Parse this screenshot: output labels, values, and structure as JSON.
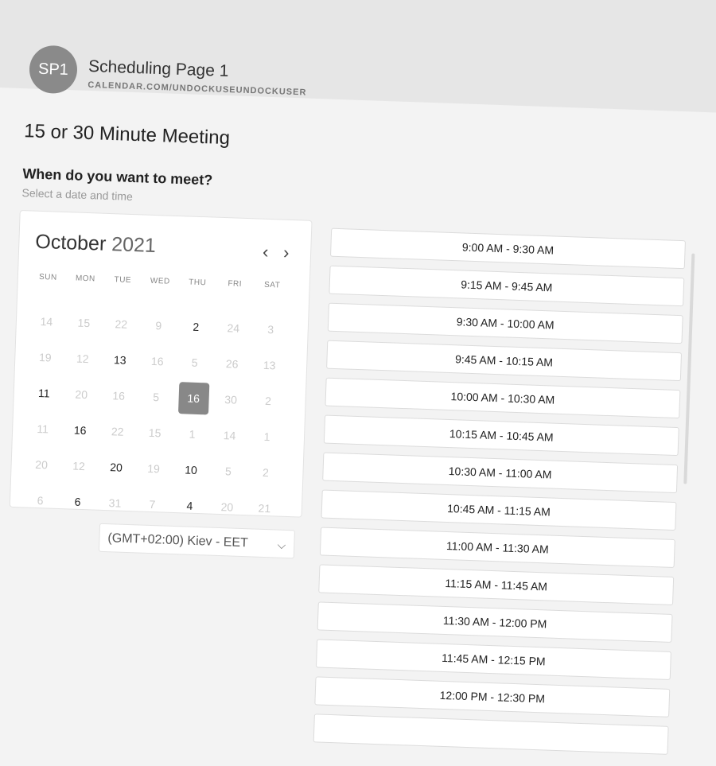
{
  "header": {
    "avatar_initials": "SP1",
    "title": "Scheduling Page 1",
    "url": "CALENDAR.COM/UNDOCKUSEUNDOCKUSER"
  },
  "meeting_title": "15 or 30 Minute Meeting",
  "question": "When do you want to meet?",
  "subquestion": "Select a date and time",
  "calendar": {
    "month": "October",
    "year": "2021",
    "prev_icon": "‹",
    "next_icon": "›",
    "weekdays": [
      "SUN",
      "MON",
      "TUE",
      "WED",
      "THU",
      "FRI",
      "SAT"
    ],
    "days": [
      {
        "n": "14",
        "a": false
      },
      {
        "n": "15",
        "a": false
      },
      {
        "n": "22",
        "a": false
      },
      {
        "n": "9",
        "a": false
      },
      {
        "n": "2",
        "a": true
      },
      {
        "n": "24",
        "a": false
      },
      {
        "n": "3",
        "a": false
      },
      {
        "n": "19",
        "a": false
      },
      {
        "n": "12",
        "a": false
      },
      {
        "n": "13",
        "a": true
      },
      {
        "n": "16",
        "a": false
      },
      {
        "n": "5",
        "a": false
      },
      {
        "n": "26",
        "a": false
      },
      {
        "n": "13",
        "a": false
      },
      {
        "n": "11",
        "a": true
      },
      {
        "n": "20",
        "a": false
      },
      {
        "n": "16",
        "a": false
      },
      {
        "n": "5",
        "a": false
      },
      {
        "n": "16",
        "a": true,
        "sel": true
      },
      {
        "n": "30",
        "a": false
      },
      {
        "n": "2",
        "a": false
      },
      {
        "n": "11",
        "a": false
      },
      {
        "n": "16",
        "a": true
      },
      {
        "n": "22",
        "a": false
      },
      {
        "n": "15",
        "a": false
      },
      {
        "n": "1",
        "a": false
      },
      {
        "n": "14",
        "a": false
      },
      {
        "n": "1",
        "a": false
      },
      {
        "n": "20",
        "a": false
      },
      {
        "n": "12",
        "a": false
      },
      {
        "n": "20",
        "a": true
      },
      {
        "n": "19",
        "a": false
      },
      {
        "n": "10",
        "a": true
      },
      {
        "n": "5",
        "a": false
      },
      {
        "n": "2",
        "a": false
      },
      {
        "n": "6",
        "a": false
      },
      {
        "n": "6",
        "a": true
      },
      {
        "n": "31",
        "a": false
      },
      {
        "n": "7",
        "a": false
      },
      {
        "n": "4",
        "a": true
      },
      {
        "n": "20",
        "a": false
      },
      {
        "n": "21",
        "a": false
      }
    ]
  },
  "timezone": {
    "value": "(GMT+02:00) Kiev - EET",
    "chevron": "⌵"
  },
  "slots": [
    "9:00 AM - 9:30 AM",
    "9:15 AM - 9:45 AM",
    "9:30 AM - 10:00 AM",
    "9:45 AM - 10:15 AM",
    "10:00 AM - 10:30 AM",
    "10:15 AM - 10:45 AM",
    "10:30 AM - 11:00 AM",
    "10:45 AM - 11:15 AM",
    "11:00 AM - 11:30 AM",
    "11:15 AM - 11:45 AM",
    "11:30 AM - 12:00 PM",
    "11:45 AM - 12:15 PM",
    "12:00 PM - 12:30 PM",
    ""
  ]
}
